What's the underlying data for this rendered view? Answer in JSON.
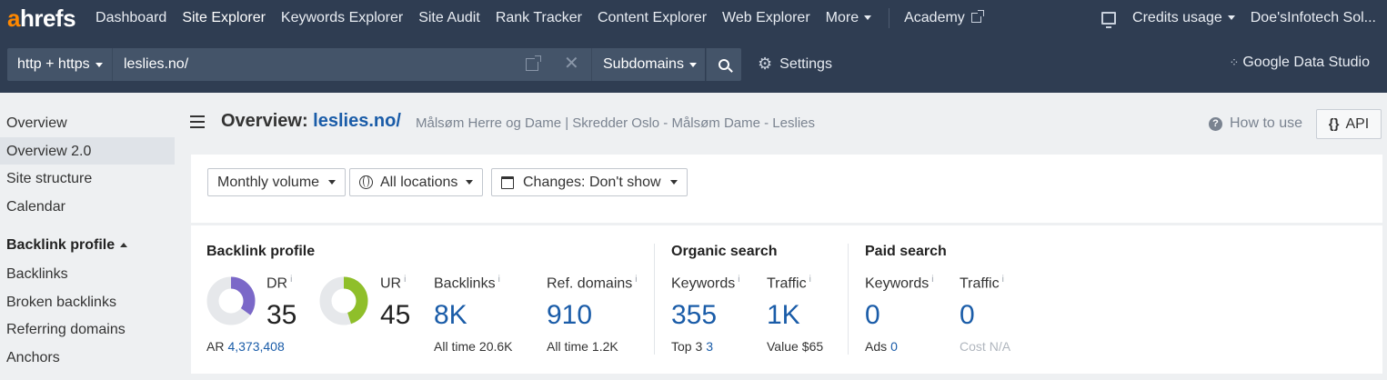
{
  "nav": {
    "logo_a": "a",
    "logo_rest": "hrefs",
    "items": [
      "Dashboard",
      "Site Explorer",
      "Keywords Explorer",
      "Site Audit",
      "Rank Tracker",
      "Content Explorer",
      "Web Explorer",
      "More"
    ],
    "active": "Site Explorer",
    "academy": "Academy",
    "credits": "Credits usage",
    "account": "Doe'sInfotech Sol..."
  },
  "search": {
    "protocol": "http + https",
    "url": "leslies.no/",
    "mode": "Subdomains",
    "settings": "Settings",
    "gds": "Google Data Studio",
    "clear_glyph": "✕"
  },
  "sidebar": {
    "items": [
      "Overview",
      "Overview 2.0",
      "Site structure",
      "Calendar"
    ],
    "active": "Overview 2.0",
    "section": "Backlink profile",
    "section_items": [
      "Backlinks",
      "Broken backlinks",
      "Referring domains",
      "Anchors"
    ]
  },
  "header": {
    "title_prefix": "Overview:",
    "target": "leslies.no/",
    "page_title": "Målsøm Herre og Dame | Skredder Oslo - Målsøm Dame - Leslies",
    "how_to": "How to use",
    "api": "API",
    "api_glyph": "{}"
  },
  "filters": {
    "volume": "Monthly volume",
    "locations": "All locations",
    "changes": "Changes: Don't show"
  },
  "metrics": {
    "backlink_profile": {
      "title": "Backlink profile",
      "dr": {
        "label": "DR",
        "value": "35",
        "fraction": 0.35,
        "color": "#7b68c8"
      },
      "ar": {
        "label": "AR",
        "value": "4,373,408"
      },
      "ur": {
        "label": "UR",
        "value": "45",
        "fraction": 0.45,
        "color": "#8fbf2a"
      },
      "backlinks": {
        "label": "Backlinks",
        "value": "8K",
        "sub_label": "All time",
        "sub_value": "20.6K"
      },
      "ref_domains": {
        "label": "Ref. domains",
        "value": "910",
        "sub_label": "All time",
        "sub_value": "1.2K"
      }
    },
    "organic": {
      "title": "Organic search",
      "keywords": {
        "label": "Keywords",
        "value": "355",
        "sub_label": "Top 3",
        "sub_value": "3"
      },
      "traffic": {
        "label": "Traffic",
        "value": "1K",
        "sub_label": "Value",
        "sub_value": "$65"
      }
    },
    "paid": {
      "title": "Paid search",
      "keywords": {
        "label": "Keywords",
        "value": "0",
        "sub_label": "Ads",
        "sub_value": "0"
      },
      "traffic": {
        "label": "Traffic",
        "value": "0",
        "sub_label": "Cost",
        "sub_value": "N/A"
      }
    },
    "info_glyph": "i"
  }
}
